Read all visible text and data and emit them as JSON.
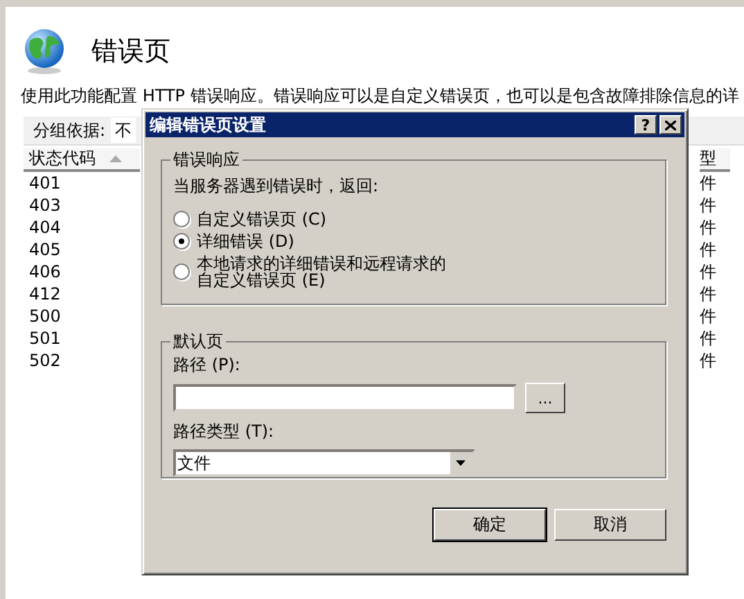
{
  "page": {
    "title": "错误页",
    "description": "使用此功能配置 HTTP 错误响应。错误响应可以是自定义错误页，也可以是包含故障排除信息的详",
    "group_by": {
      "label": "分组依据:",
      "value": "不"
    },
    "table": {
      "columns": [
        "状态代码",
        "型"
      ],
      "rows": [
        {
          "code": "401",
          "column_2": "件"
        },
        {
          "code": "403",
          "column_2": "件"
        },
        {
          "code": "404",
          "column_2": "件"
        },
        {
          "code": "405",
          "column_2": "件"
        },
        {
          "code": "406",
          "column_2": "件"
        },
        {
          "code": "412",
          "column_2": "件"
        },
        {
          "code": "500",
          "column_2": "件"
        },
        {
          "code": "501",
          "column_2": "件"
        },
        {
          "code": "502",
          "column_2": "件"
        }
      ]
    }
  },
  "dialog": {
    "title": "编辑错误页设置",
    "help": "?",
    "error_response": {
      "legend": "错误响应",
      "prompt": "当服务器遇到错误时，返回:",
      "options": [
        {
          "label": "自定义错误页 (C)",
          "selected": false
        },
        {
          "label": "详细错误 (D)",
          "selected": true
        },
        {
          "label": "本地请求的详细错误和远程请求的自定义错误页 (E)",
          "selected": false
        }
      ]
    },
    "default_page": {
      "legend": "默认页",
      "path_label": "路径 (P):",
      "browse": "...",
      "path_type_label": "路径类型 (T):",
      "path_type_value": "文件"
    },
    "buttons": [
      {
        "label": "确定",
        "default": true
      },
      {
        "label": "取消",
        "default": false
      }
    ]
  }
}
